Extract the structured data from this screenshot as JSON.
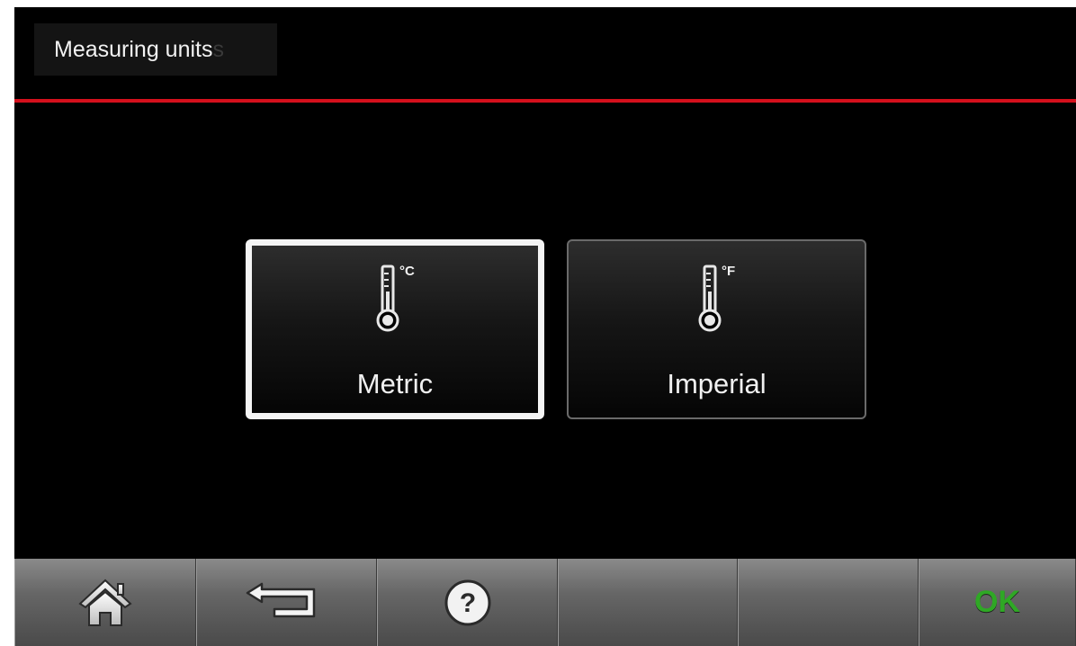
{
  "header": {
    "title": "Measuring units",
    "title_ghost": "s"
  },
  "options": [
    {
      "label": "Metric",
      "unit": "°C",
      "icon": "thermometer-icon",
      "selected": true
    },
    {
      "label": "Imperial",
      "unit": "°F",
      "icon": "thermometer-icon",
      "selected": false
    }
  ],
  "toolbar": {
    "home_icon": "home-icon",
    "back_icon": "back-arrow-icon",
    "help_icon": "help-icon",
    "ok_label": "OK"
  },
  "colors": {
    "accent_red": "#d4101c",
    "ok_green": "#2fa825",
    "background": "#000000"
  }
}
